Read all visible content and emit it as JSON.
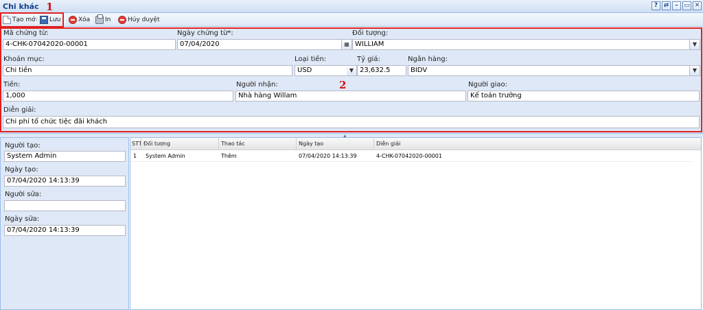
{
  "window": {
    "title": "Chi khác",
    "buttons": [
      {
        "name": "help-icon",
        "glyph": "?"
      },
      {
        "name": "refresh-icon",
        "glyph": "⇄"
      },
      {
        "name": "minimize-icon",
        "glyph": "–"
      },
      {
        "name": "restore-icon",
        "glyph": "▭"
      },
      {
        "name": "close-icon",
        "glyph": "✕"
      }
    ]
  },
  "toolbar": {
    "new_label": "Tạo mới",
    "save_label": "Lưu",
    "delete_label": "Xóa",
    "print_label": "In",
    "unapprove_label": "Hủy duyệt"
  },
  "annotations": {
    "one": "1",
    "two": "2"
  },
  "form": {
    "voucher_code": {
      "label": "Mã chứng từ:",
      "value": "4-CHK-07042020-00001"
    },
    "voucher_date": {
      "label": "Ngày chứng từ*:",
      "value": "07/04/2020"
    },
    "partner": {
      "label": "Đối tượng:",
      "value": "WILLIAM"
    },
    "category": {
      "label": "Khoản mục:",
      "value": "Chi tiền"
    },
    "currency": {
      "label": "Loại tiền:",
      "value": "USD"
    },
    "rate": {
      "label": "Tỷ giá:",
      "value": "23,632.5"
    },
    "bank": {
      "label": "Ngân hàng:",
      "value": "BIDV"
    },
    "amount": {
      "label": "Tiền:",
      "value": "1,000"
    },
    "receiver": {
      "label": "Người nhận:",
      "value": "Nhà hàng Willam"
    },
    "deliverer": {
      "label": "Người giao:",
      "value": "Kế toán trưởng"
    },
    "description": {
      "label": "Diễn giải:",
      "value": "Chi phí tổ chức tiệc đãi khách"
    }
  },
  "info": {
    "created_by": {
      "label": "Người tạo:",
      "value": "System Admin"
    },
    "created_at": {
      "label": "Ngày tạo:",
      "value": "07/04/2020 14:13:39"
    },
    "modified_by": {
      "label": "Người sửa:",
      "value": ""
    },
    "modified_at": {
      "label": "Ngày sửa:",
      "value": "07/04/2020 14:13:39"
    }
  },
  "history": {
    "columns": [
      "STT",
      "Đối tượng",
      "Thao tác",
      "Ngày tạo",
      "Diễn giải"
    ],
    "rows": [
      [
        "1",
        "System Admin",
        "Thêm",
        "07/04/2020 14:13:39",
        "4-CHK-07042020-00001"
      ]
    ]
  },
  "colors": {
    "accent": "#15428b",
    "panel_bg": "#dfe8f6",
    "highlight": "#e02020"
  }
}
